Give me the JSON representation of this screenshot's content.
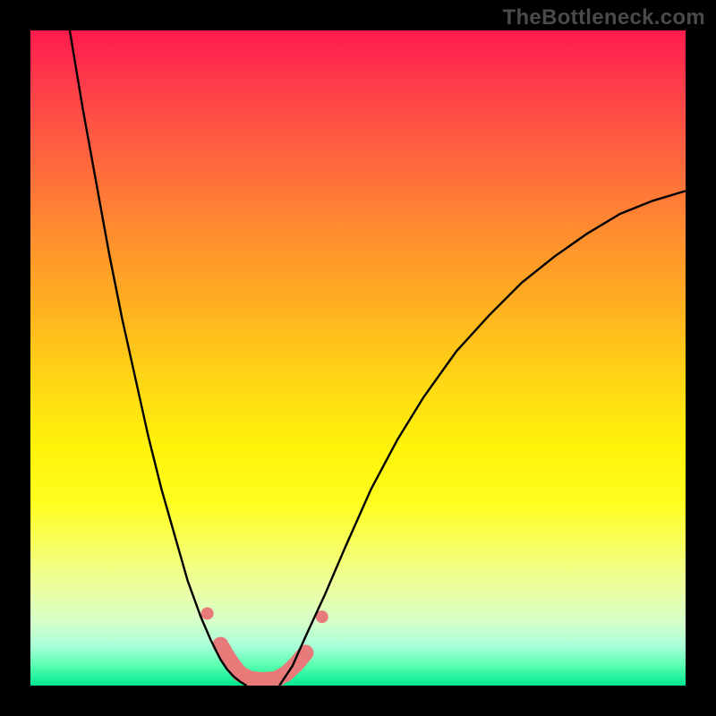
{
  "watermark": "TheBottleneck.com",
  "domain_x": [
    0,
    1
  ],
  "domain_y": [
    0,
    1
  ],
  "chart_data": {
    "type": "line",
    "title": "",
    "xlabel": "",
    "ylabel": "",
    "xlim": [
      0,
      1
    ],
    "ylim": [
      0,
      1
    ],
    "legend": false,
    "grid": false,
    "series": [
      {
        "name": "left-curve",
        "stroke": "#000000",
        "stroke_width": 2.4,
        "x": [
          0.06,
          0.08,
          0.1,
          0.12,
          0.14,
          0.16,
          0.18,
          0.2,
          0.22,
          0.24,
          0.26,
          0.275,
          0.29,
          0.3,
          0.31,
          0.32,
          0.33
        ],
        "y": [
          1.0,
          0.88,
          0.77,
          0.66,
          0.56,
          0.47,
          0.38,
          0.3,
          0.23,
          0.16,
          0.105,
          0.07,
          0.04,
          0.025,
          0.014,
          0.006,
          0.0
        ]
      },
      {
        "name": "right-curve",
        "stroke": "#000000",
        "stroke_width": 2.4,
        "x": [
          0.38,
          0.4,
          0.42,
          0.45,
          0.48,
          0.52,
          0.56,
          0.6,
          0.65,
          0.7,
          0.75,
          0.8,
          0.85,
          0.9,
          0.95,
          1.0
        ],
        "y": [
          0.0,
          0.03,
          0.075,
          0.14,
          0.21,
          0.3,
          0.375,
          0.44,
          0.51,
          0.565,
          0.615,
          0.655,
          0.69,
          0.72,
          0.74,
          0.755
        ]
      },
      {
        "name": "bottom-connector",
        "stroke": "#e97a7a",
        "stroke_width": 18,
        "linecap": "round",
        "linejoin": "round",
        "x": [
          0.29,
          0.3,
          0.31,
          0.32,
          0.335,
          0.355,
          0.375,
          0.39,
          0.405,
          0.42
        ],
        "y": [
          0.062,
          0.045,
          0.03,
          0.018,
          0.01,
          0.008,
          0.01,
          0.018,
          0.032,
          0.05
        ]
      },
      {
        "name": "marker-left-upper",
        "type": "scatter",
        "fill": "#e97a7a",
        "radius": 7,
        "x": [
          0.27
        ],
        "y": [
          0.11
        ]
      },
      {
        "name": "marker-right-upper",
        "type": "scatter",
        "fill": "#e97a7a",
        "radius": 7,
        "x": [
          0.445
        ],
        "y": [
          0.105
        ]
      }
    ],
    "background_gradient": {
      "direction": "top-to-bottom",
      "stops": [
        {
          "pos": 0.0,
          "color": "#ff1a4d"
        },
        {
          "pos": 0.3,
          "color": "#ff8a30"
        },
        {
          "pos": 0.64,
          "color": "#fff40a"
        },
        {
          "pos": 0.86,
          "color": "#ecffa0"
        },
        {
          "pos": 1.0,
          "color": "#00e890"
        }
      ]
    }
  }
}
